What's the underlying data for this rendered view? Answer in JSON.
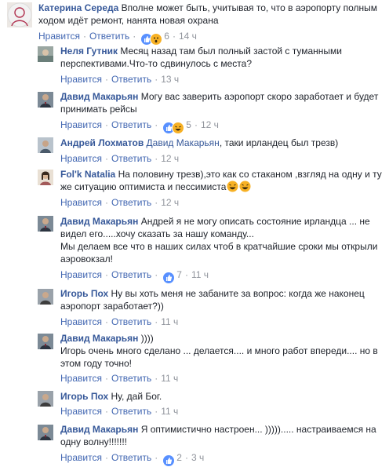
{
  "labels": {
    "like": "Нравится",
    "reply": "Ответить",
    "sep": "·"
  },
  "comments": [
    {
      "author": "Катерина Середа",
      "text": "Вполне может быть, учитывая то, что в аэропорту полным ходом идёт ремонт, нанята новая охрана",
      "reactions": [
        "like",
        "wow"
      ],
      "count": "6",
      "time": "14 ч"
    },
    {
      "author": "Неля Гутник",
      "text": "Месяц назад там был полный застой с туманными перспективами.Что-то сдвинулось с места?",
      "reactions": [],
      "count": "",
      "time": "13 ч"
    },
    {
      "author": "Давид Макарьян",
      "text": "Могу вас заверить аэропорт скоро заработает и будет принимать рейсы",
      "reactions": [
        "like",
        "haha"
      ],
      "count": "5",
      "time": "12 ч"
    },
    {
      "author": "Андрей Лохматов",
      "mention": "Давид Макарьян",
      "text": ", таки ирландец был трезв)",
      "reactions": [],
      "count": "",
      "time": "12 ч"
    },
    {
      "author": "Fol'k Natalia",
      "text": "На половину трезв),это как со стаканом ,взгляд на одну и ту же ситуацию оптимиста и пессимиста",
      "reactions": [],
      "count": "",
      "time": "12 ч"
    },
    {
      "author": "Давид Макарьян",
      "text": "Андрей я не могу описать состояние ирландца ... не видел его.....хочу сказать за нашу команду...",
      "text2": "Мы делаем все что в наших силах чтоб в кратчайшие сроки мы открыли аэровокзал!",
      "reactions": [
        "like"
      ],
      "count": "7",
      "time": "11 ч"
    },
    {
      "author": "Игорь Пох",
      "text": "Ну вы хоть меня не забаните за вопрос: когда же наконец аэропорт заработает?))",
      "reactions": [],
      "count": "",
      "time": "11 ч"
    },
    {
      "author": "Давид Макарьян",
      "text": "))))",
      "text2": "Игорь очень много сделано ... делается.... и много работ впереди.... но в этом году точно!",
      "reactions": [],
      "count": "",
      "time": "11 ч"
    },
    {
      "author": "Игорь Пох",
      "text": "Ну, дай Бог.",
      "reactions": [],
      "count": "",
      "time": "11 ч"
    },
    {
      "author": "Давид Макарьян",
      "text": "Я оптимистично настроен... )))))..... настраиваемся на одну волну!!!!!!!",
      "reactions": [],
      "count": "2",
      "time": "3 ч"
    }
  ],
  "colors": {
    "link": "#365899",
    "meta": "#90949c",
    "likeBlue": "#5890ff",
    "emojiYellow": "#f7b125"
  }
}
